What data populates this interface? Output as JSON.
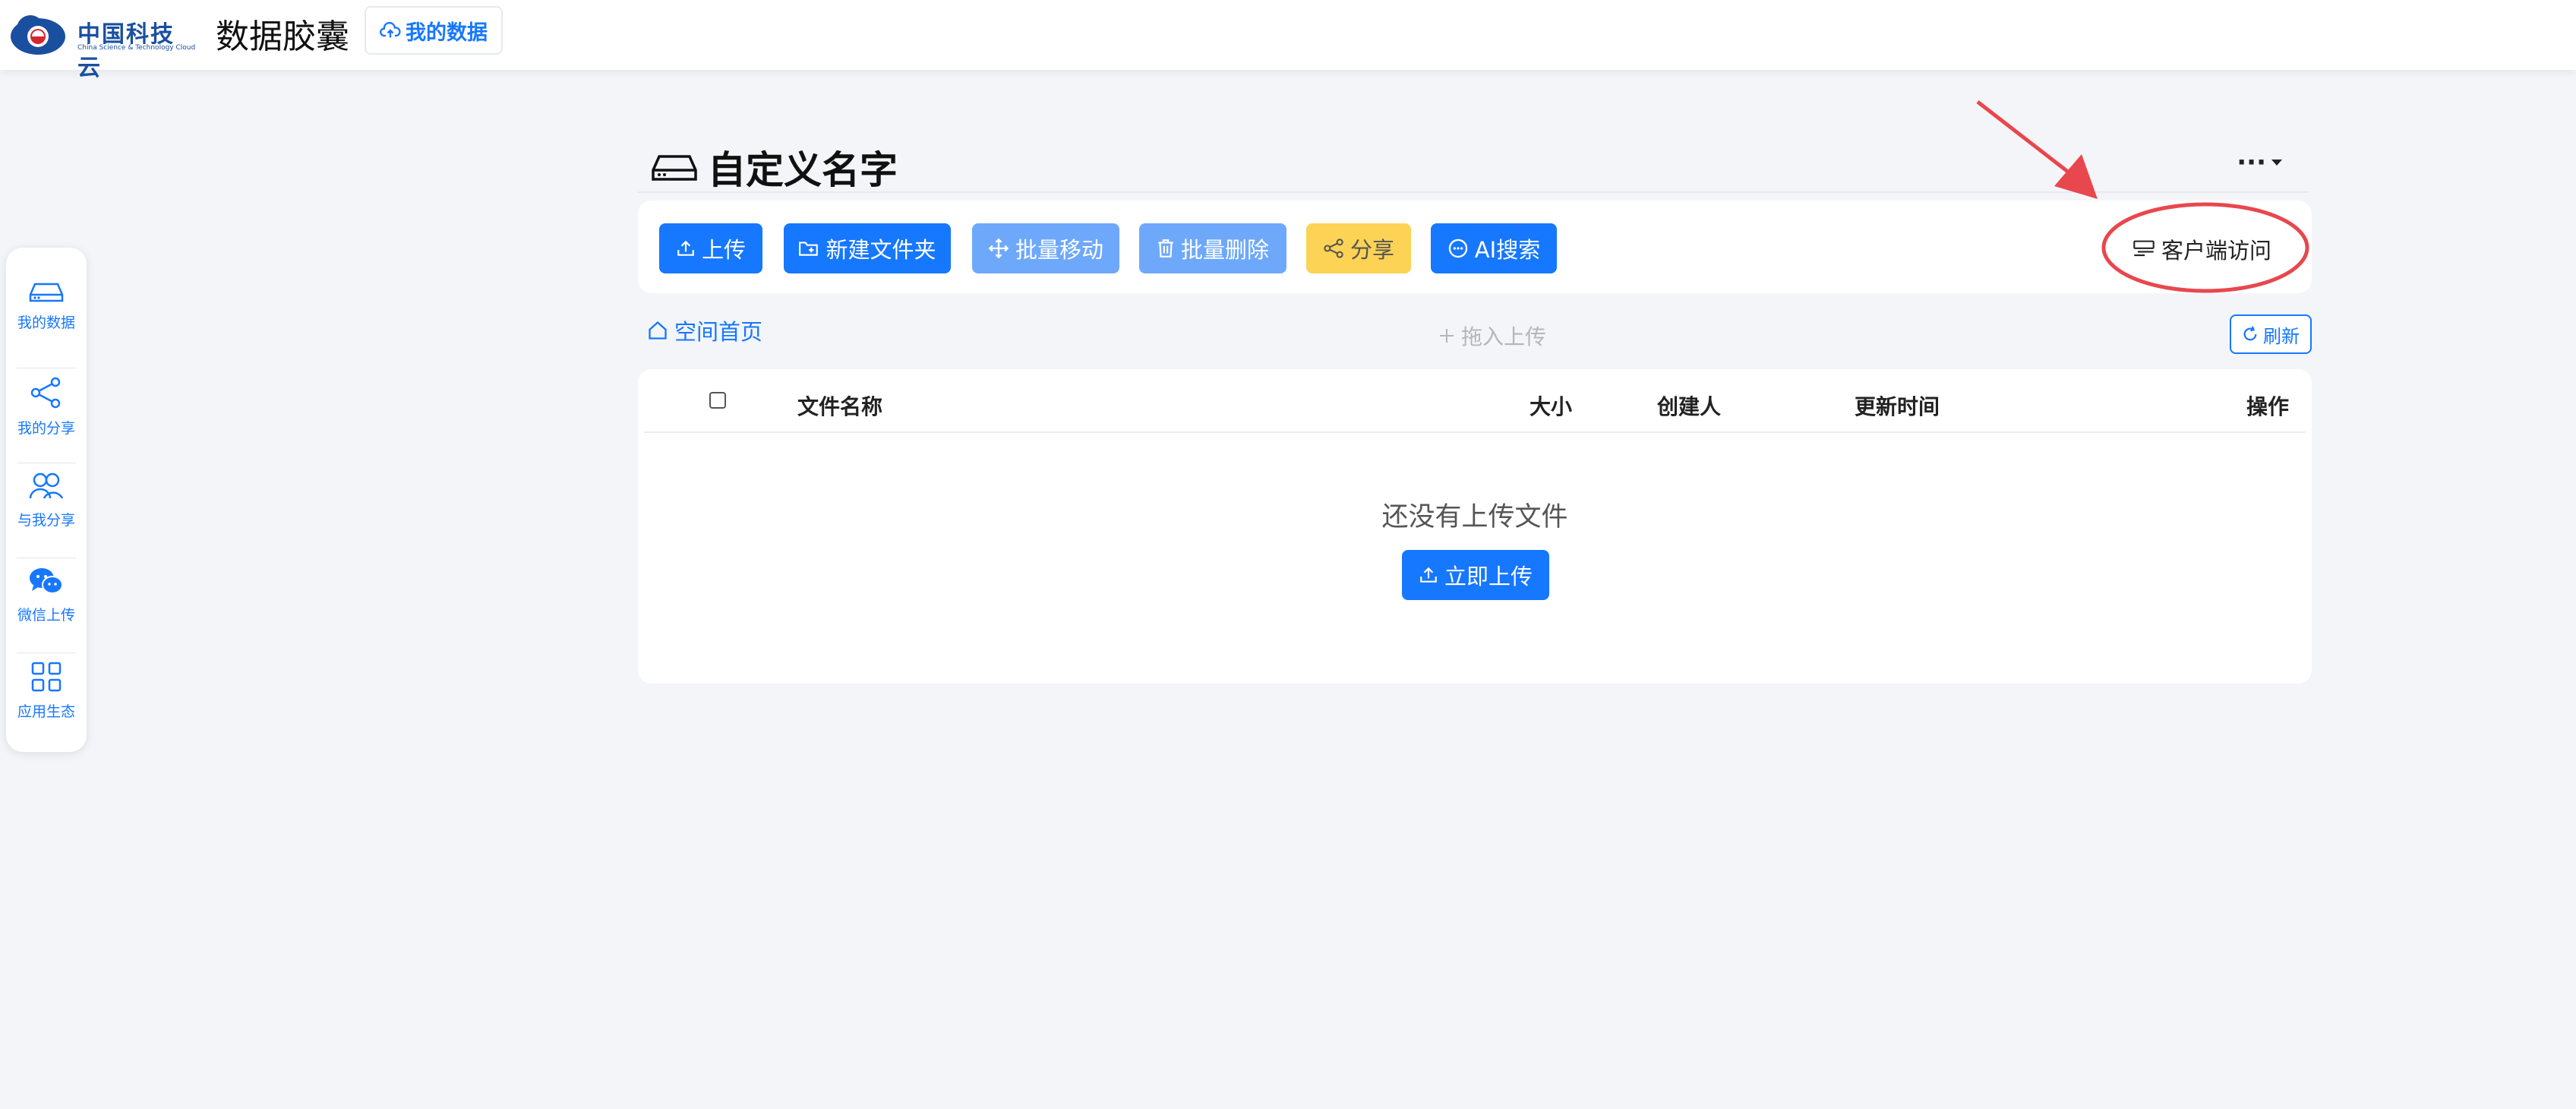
{
  "header": {
    "logo_cn": "中国科技云",
    "logo_en": "China Science & Technology Cloud",
    "app_title": "数据胶囊",
    "nav_tab_label": "我的数据"
  },
  "sidebar": {
    "items": [
      {
        "label": "我的数据",
        "icon": "drive-icon"
      },
      {
        "label": "我的分享",
        "icon": "share-icon"
      },
      {
        "label": "与我分享",
        "icon": "users-icon"
      },
      {
        "label": "微信上传",
        "icon": "wechat-icon"
      },
      {
        "label": "应用生态",
        "icon": "apps-grid-icon"
      }
    ]
  },
  "page": {
    "title": "自定义名字",
    "more_label": "···"
  },
  "toolbar": {
    "upload": "上传",
    "new_folder": "新建文件夹",
    "batch_move": "批量移动",
    "batch_delete": "批量删除",
    "share": "分享",
    "ai_search": "AI搜索",
    "client_access": "客户端访问"
  },
  "nav": {
    "breadcrumb_home": "空间首页",
    "drag_upload": "拖入上传",
    "refresh": "刷新"
  },
  "table": {
    "columns": [
      "文件名称",
      "大小",
      "创建人",
      "更新时间",
      "操作"
    ],
    "empty_text": "还没有上传文件",
    "upload_now": "立即上传"
  },
  "colors": {
    "primary": "#1677ff",
    "primary_disabled": "#6ea8fb",
    "warn": "#fdd356",
    "annotation": "#e8474d",
    "background": "#f4f5f9"
  }
}
